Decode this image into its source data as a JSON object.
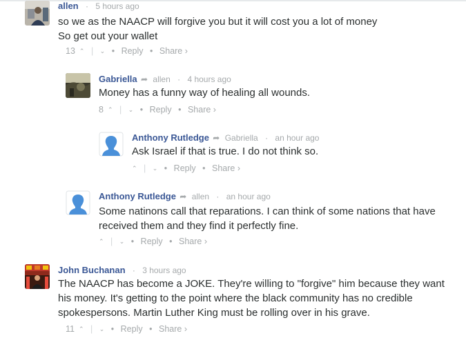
{
  "comments": [
    {
      "author": "allen",
      "time": "5 hours ago",
      "reply_to": "",
      "lines": [
        "so we as the NAACP will forgive you but it will cost you a lot of money",
        "So get out your wallet"
      ],
      "votes": "13",
      "actions": {
        "reply": "Reply",
        "share": "Share ›"
      },
      "avatar": "photo"
    },
    {
      "author": "Gabriella",
      "time": "4 hours ago",
      "reply_to": "allen",
      "lines": [
        "Money has a funny way of healing all wounds."
      ],
      "votes": "8",
      "actions": {
        "reply": "Reply",
        "share": "Share ›"
      },
      "avatar": "photo"
    },
    {
      "author": "Anthony Rutledge",
      "time": "an hour ago",
      "reply_to": "Gabriella",
      "lines": [
        "Ask Israel if that is true. I do not think so."
      ],
      "votes": "",
      "actions": {
        "reply": "Reply",
        "share": "Share ›"
      },
      "avatar": "default"
    },
    {
      "author": "Anthony Rutledge",
      "time": "an hour ago",
      "reply_to": "allen",
      "lines": [
        "Some natinons call that reparations. I can think of some nations that have",
        "received them and they find it perfectly fine."
      ],
      "votes": "",
      "actions": {
        "reply": "Reply",
        "share": "Share ›"
      },
      "avatar": "default"
    },
    {
      "author": "John Buchanan",
      "time": "3 hours ago",
      "reply_to": "",
      "lines": [
        "The NAACP has become a JOKE. They're willing to \"forgive\" him because they want",
        "his money. It's getting to the point where the black community has no credible",
        "spokespersons. Martin Luther King must be rolling over in his grave."
      ],
      "votes": "11",
      "actions": {
        "reply": "Reply",
        "share": "Share ›"
      },
      "avatar": "photo"
    }
  ],
  "colors": {
    "author": "#3a5795",
    "meta": "#a5a9ab",
    "text": "#2a2e2e",
    "default_avatar": "#4a90d9"
  }
}
